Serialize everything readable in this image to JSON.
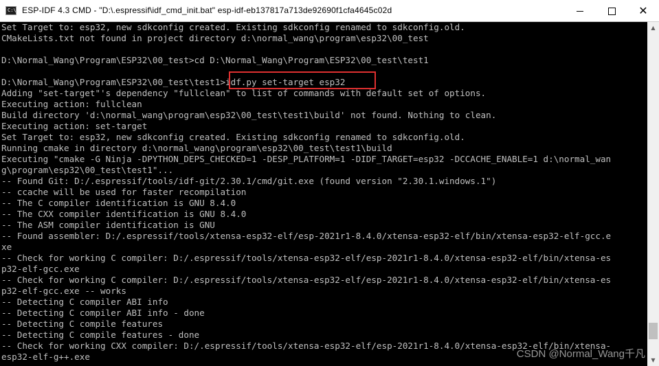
{
  "window": {
    "title": "ESP-IDF 4.3 CMD - \"D:\\.espressif\\idf_cmd_init.bat\"  esp-idf-eb137817a713de92690f1cfa4645c02d",
    "icon_label": "C:\\",
    "controls": {
      "minimize": "minimize",
      "maximize": "maximize",
      "close": "✕"
    }
  },
  "terminal": {
    "lines": [
      "Set Target to: esp32, new sdkconfig created. Existing sdkconfig renamed to sdkconfig.old.",
      "CMakeLists.txt not found in project directory d:\\normal_wang\\program\\esp32\\00_test",
      "",
      "D:\\Normal_Wang\\Program\\ESP32\\00_test>cd D:\\Normal_Wang\\Program\\ESP32\\00_test\\test1",
      "",
      "D:\\Normal_Wang\\Program\\ESP32\\00_test\\test1>idf.py set-target esp32",
      "Adding \"set-target\"'s dependency \"fullclean\" to list of commands with default set of options.",
      "Executing action: fullclean",
      "Build directory 'd:\\normal_wang\\program\\esp32\\00_test\\test1\\build' not found. Nothing to clean.",
      "Executing action: set-target",
      "Set Target to: esp32, new sdkconfig created. Existing sdkconfig renamed to sdkconfig.old.",
      "Running cmake in directory d:\\normal_wang\\program\\esp32\\00_test\\test1\\build",
      "Executing \"cmake -G Ninja -DPYTHON_DEPS_CHECKED=1 -DESP_PLATFORM=1 -DIDF_TARGET=esp32 -DCCACHE_ENABLE=1 d:\\normal_wan",
      "g\\program\\esp32\\00_test\\test1\"...",
      "-- Found Git: D:/.espressif/tools/idf-git/2.30.1/cmd/git.exe (found version \"2.30.1.windows.1\")",
      "-- ccache will be used for faster recompilation",
      "-- The C compiler identification is GNU 8.4.0",
      "-- The CXX compiler identification is GNU 8.4.0",
      "-- The ASM compiler identification is GNU",
      "-- Found assembler: D:/.espressif/tools/xtensa-esp32-elf/esp-2021r1-8.4.0/xtensa-esp32-elf/bin/xtensa-esp32-elf-gcc.e",
      "xe",
      "-- Check for working C compiler: D:/.espressif/tools/xtensa-esp32-elf/esp-2021r1-8.4.0/xtensa-esp32-elf/bin/xtensa-es",
      "p32-elf-gcc.exe",
      "-- Check for working C compiler: D:/.espressif/tools/xtensa-esp32-elf/esp-2021r1-8.4.0/xtensa-esp32-elf/bin/xtensa-es",
      "p32-elf-gcc.exe -- works",
      "-- Detecting C compiler ABI info",
      "-- Detecting C compiler ABI info - done",
      "-- Detecting C compile features",
      "-- Detecting C compile features - done",
      "-- Check for working CXX compiler: D:/.espressif/tools/xtensa-esp32-elf/esp-2021r1-8.4.0/xtensa-esp32-elf/bin/xtensa-",
      "esp32-elf-g++.exe"
    ]
  },
  "scrollbar": {
    "up_arrow": "▲",
    "down_arrow": "▼",
    "position": 0.95
  },
  "watermark": "CSDN @Normal_Wang千凡",
  "colors": {
    "background": "#000000",
    "text": "#c0c0c0",
    "highlight_border": "#e03030"
  }
}
